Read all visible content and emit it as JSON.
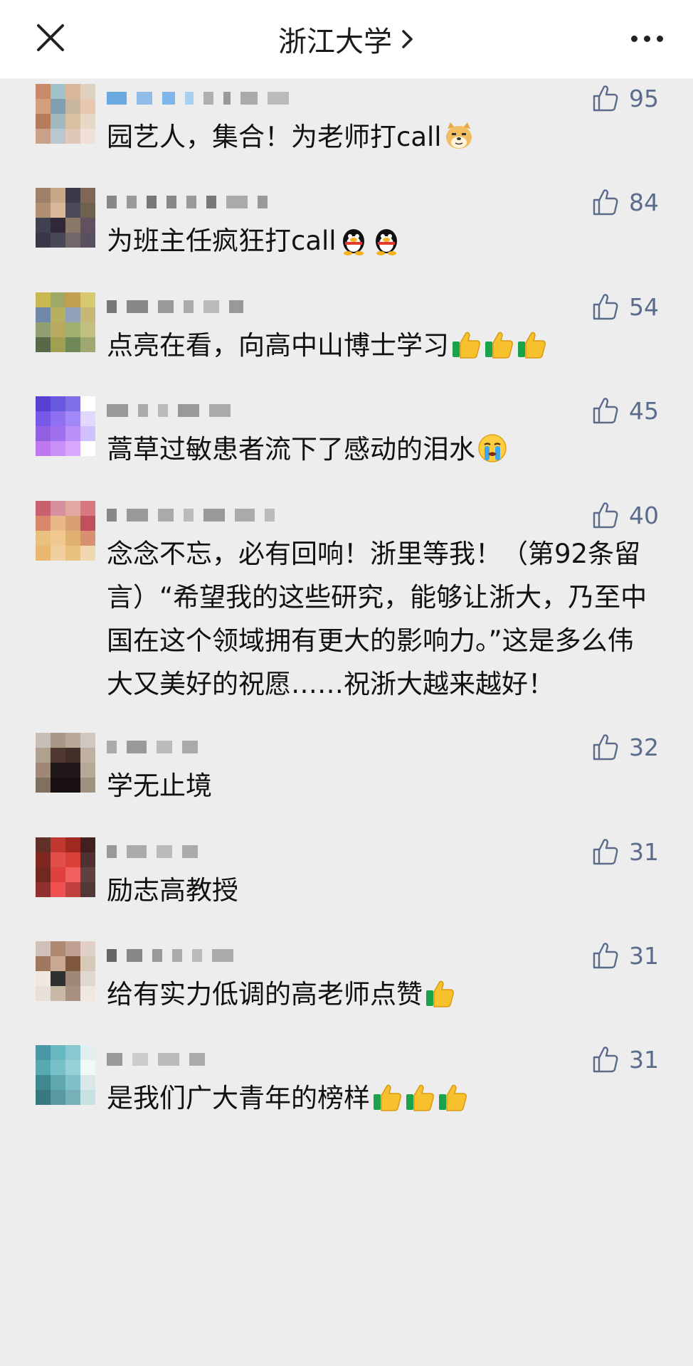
{
  "header": {
    "title": "浙江大学",
    "close_icon": "close-icon",
    "more_icon": "more-dots-icon"
  },
  "colors": {
    "header_bg": "#ffffff",
    "page_bg": "#ededed",
    "like_color": "#5b6b8c"
  },
  "comments": [
    {
      "text": "园艺人，集合！为老师打call",
      "likes": "95",
      "emojis": [
        "doge"
      ]
    },
    {
      "text": "为班主任疯狂打call",
      "likes": "84",
      "emojis": [
        "penguin",
        "penguin"
      ]
    },
    {
      "text": "点亮在看，向高中山博士学习",
      "likes": "54",
      "emojis": [
        "thumbs-up",
        "thumbs-up",
        "thumbs-up"
      ]
    },
    {
      "text": "蒿草过敏患者流下了感动的泪水",
      "likes": "45",
      "emojis": [
        "crying"
      ]
    },
    {
      "text": "念念不忘，必有回响！浙里等我！（第92条留言）“希望我的这些研究，能够让浙大，乃至中国在这个领域拥有更大的影响力。”这是多么伟大又美好的祝愿……祝浙大越来越好！",
      "likes": "40",
      "emojis": []
    },
    {
      "text": "学无止境",
      "likes": "32",
      "emojis": []
    },
    {
      "text": "励志高教授",
      "likes": "31",
      "emojis": []
    },
    {
      "text": "给有实力低调的高老师点赞",
      "likes": "31",
      "emojis": [
        "thumbs-up"
      ]
    },
    {
      "text": "是我们广大青年的榜样",
      "likes": "31",
      "emojis": [
        "thumbs-up",
        "thumbs-up",
        "thumbs-up"
      ]
    }
  ]
}
